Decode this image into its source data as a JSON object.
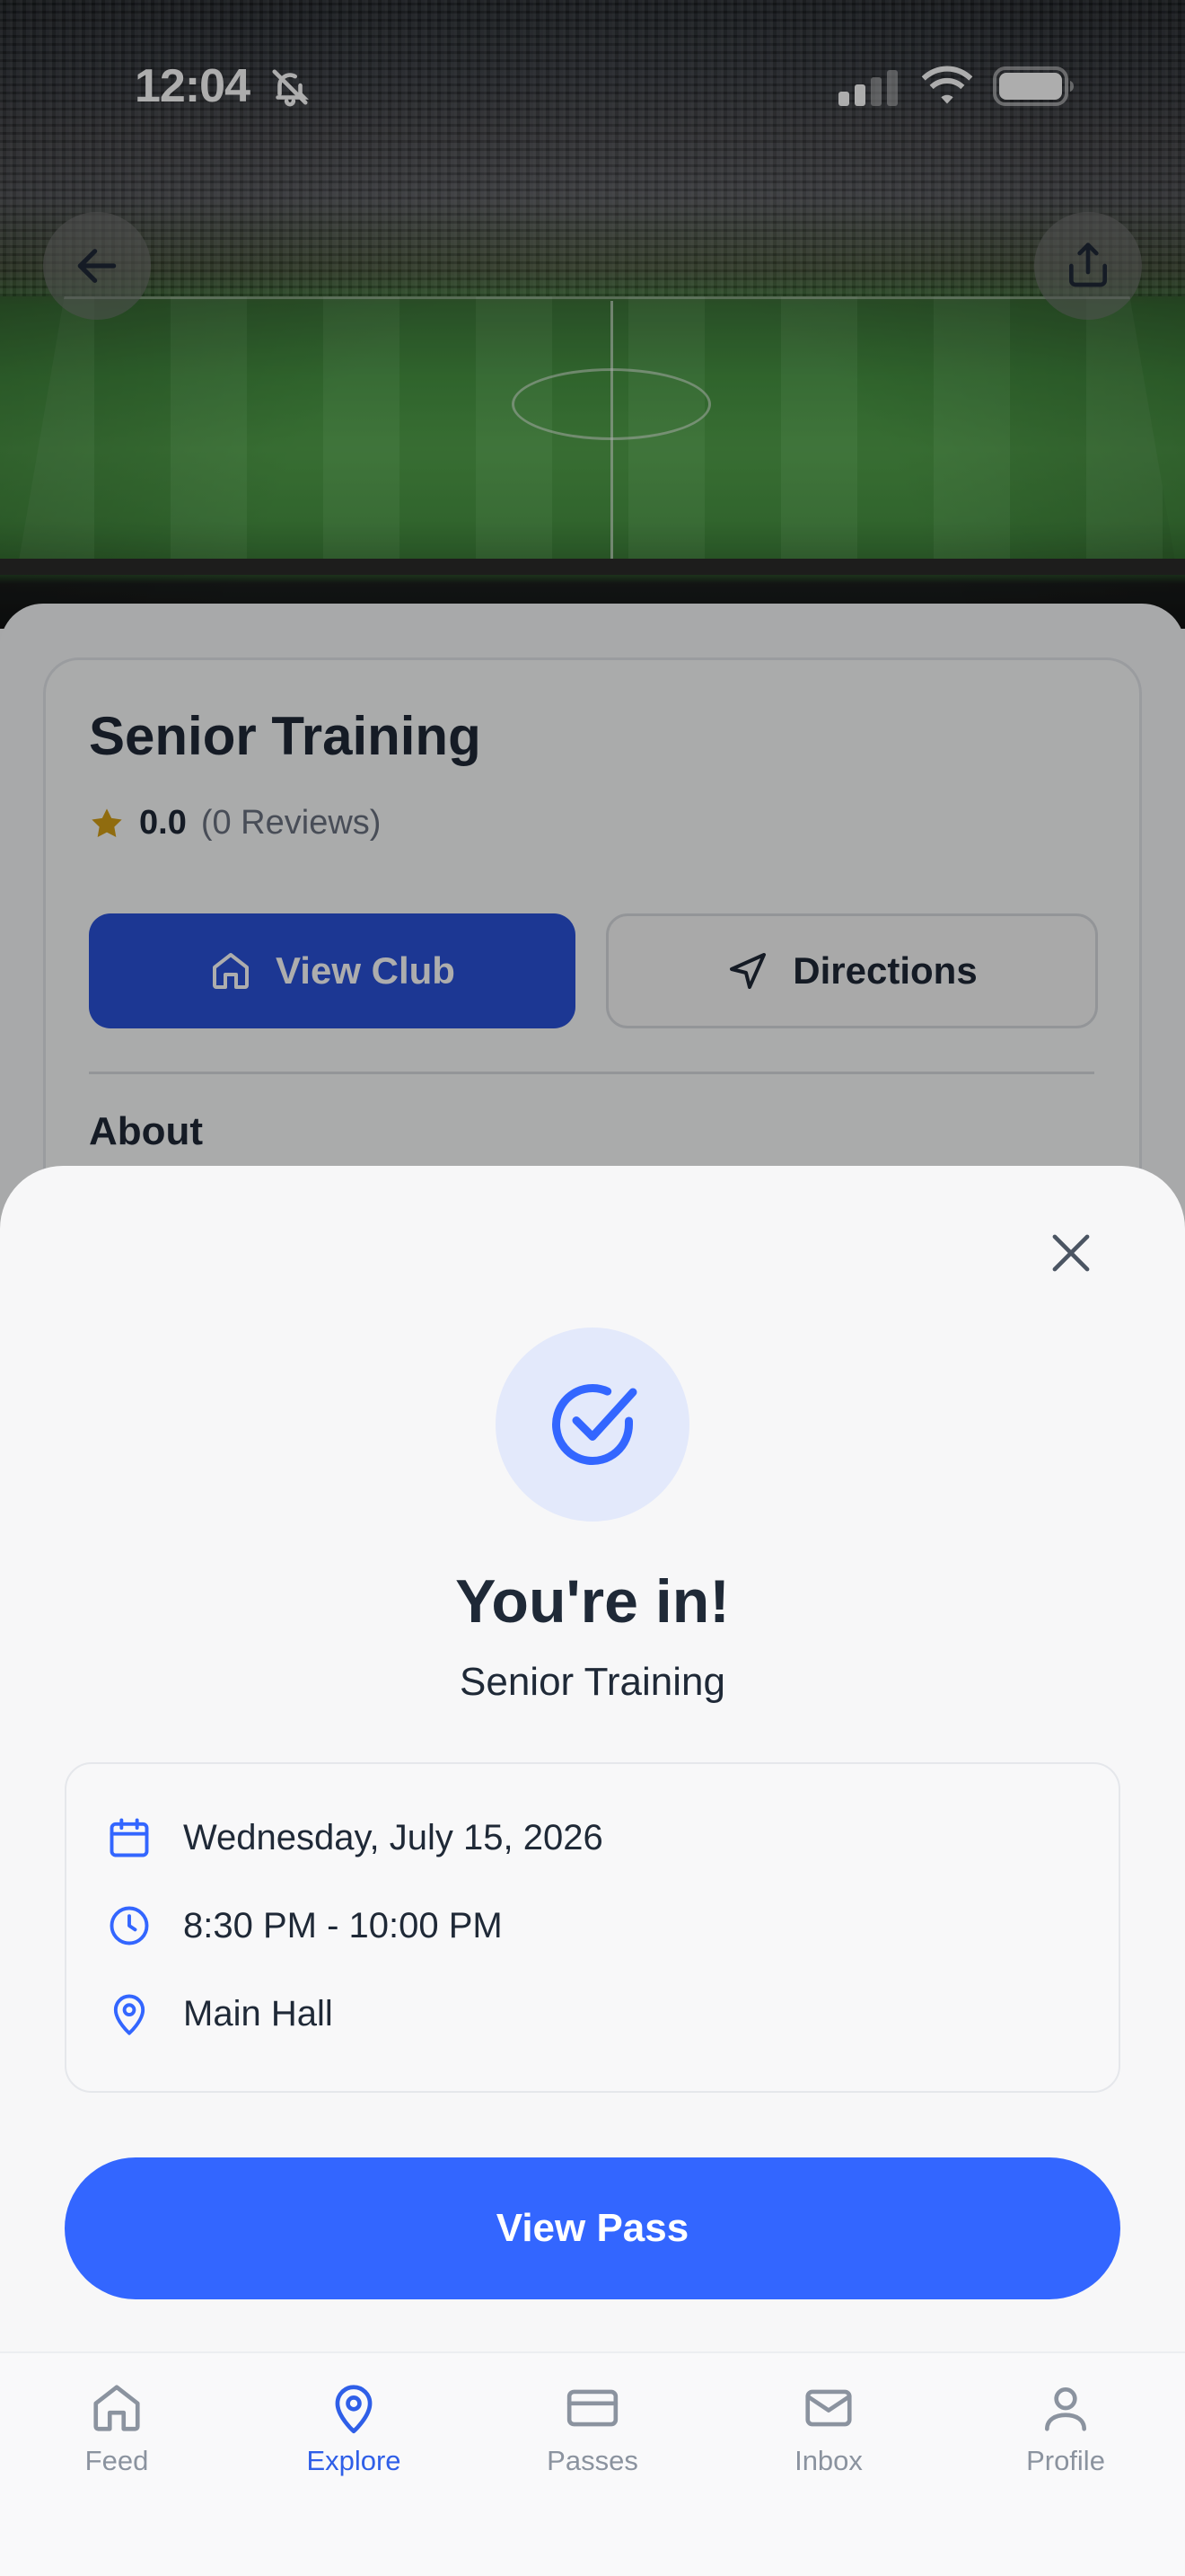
{
  "status_bar": {
    "time": "12:04"
  },
  "event": {
    "title": "Senior Training",
    "rating_score": "0.0",
    "rating_count": "(0 Reviews)",
    "view_club_label": "View Club",
    "directions_label": "Directions",
    "about_heading": "About"
  },
  "sheet": {
    "title": "You're in!",
    "subtitle": "Senior Training",
    "date": "Wednesday, July 15, 2026",
    "time": "8:30 PM - 10:00 PM",
    "location": "Main Hall",
    "view_pass_label": "View Pass"
  },
  "tabs": [
    {
      "label": "Feed",
      "icon": "home-icon",
      "active": false
    },
    {
      "label": "Explore",
      "icon": "map-pin-icon",
      "active": true
    },
    {
      "label": "Passes",
      "icon": "ticket-icon",
      "active": false
    },
    {
      "label": "Inbox",
      "icon": "mail-icon",
      "active": false
    },
    {
      "label": "Profile",
      "icon": "user-icon",
      "active": false
    }
  ],
  "colors": {
    "primary": "#3366ff",
    "club_button": "#2a52d9",
    "active_tab": "#2f5fe8",
    "inactive_tab": "#8b939f",
    "star": "#d4a017"
  }
}
